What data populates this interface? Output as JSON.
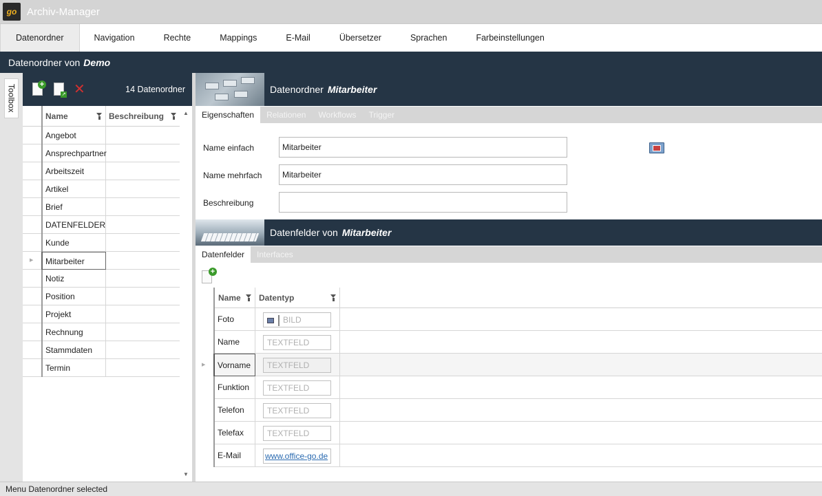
{
  "window": {
    "logo_text": "go",
    "title": "Archiv-Manager"
  },
  "menu": {
    "items": [
      {
        "label": "Datenordner"
      },
      {
        "label": "Navigation"
      },
      {
        "label": "Rechte"
      },
      {
        "label": "Mappings"
      },
      {
        "label": "E-Mail"
      },
      {
        "label": "Übersetzer"
      },
      {
        "label": "Sprachen"
      },
      {
        "label": "Farbeinstellungen"
      }
    ],
    "active_index": 0
  },
  "section": {
    "prefix": "Datenordner von",
    "name": "Demo"
  },
  "toolbox": {
    "label": "Toolbox"
  },
  "left": {
    "count_text": "14 Datenordner",
    "columns": {
      "name": "Name",
      "description": "Beschreibung"
    },
    "rows": [
      {
        "name": "Angebot"
      },
      {
        "name": "Ansprechpartner"
      },
      {
        "name": "Arbeitszeit"
      },
      {
        "name": "Artikel"
      },
      {
        "name": "Brief"
      },
      {
        "name": "DATENFELDER"
      },
      {
        "name": "Kunde"
      },
      {
        "name": "Mitarbeiter"
      },
      {
        "name": "Notiz"
      },
      {
        "name": "Position"
      },
      {
        "name": "Projekt"
      },
      {
        "name": "Rechnung"
      },
      {
        "name": "Stammdaten"
      },
      {
        "name": "Termin"
      }
    ],
    "selected_index": 7
  },
  "folder": {
    "header_prefix": "Datenordner",
    "header_name": "Mitarbeiter",
    "tabs": [
      {
        "label": "Eigenschaften"
      },
      {
        "label": "Relationen"
      },
      {
        "label": "Workflows"
      },
      {
        "label": "Trigger"
      }
    ],
    "active_tab": 0,
    "form": {
      "name_single_label": "Name einfach",
      "name_single_value": "Mitarbeiter",
      "name_plural_label": "Name mehrfach",
      "name_plural_value": "Mitarbeiter",
      "description_label": "Beschreibung",
      "description_value": ""
    }
  },
  "fields": {
    "header_prefix": "Datenfelder von",
    "header_name": "Mitarbeiter",
    "tabs": [
      {
        "label": "Datenfelder"
      },
      {
        "label": "Interfaces"
      }
    ],
    "active_tab": 0,
    "columns": {
      "name": "Name",
      "type": "Datentyp"
    },
    "rows": [
      {
        "name": "Foto",
        "type": "BILD",
        "kind": "image"
      },
      {
        "name": "Name",
        "type": "TEXTFELD",
        "kind": "text"
      },
      {
        "name": "Vorname",
        "type": "TEXTFELD",
        "kind": "text-disabled"
      },
      {
        "name": "Funktion",
        "type": "TEXTFELD",
        "kind": "text"
      },
      {
        "name": "Telefon",
        "type": "TEXTFELD",
        "kind": "text"
      },
      {
        "name": "Telefax",
        "type": "TEXTFELD",
        "kind": "text"
      },
      {
        "name": "E-Mail",
        "type": "www.office-go.de",
        "kind": "link"
      }
    ],
    "selected_index": 2
  },
  "status": {
    "text": "Menu Datenordner selected"
  },
  "colors": {
    "header_bg": "#253545",
    "tab_bar": "#d6d6d6",
    "menu_active": "#ececec",
    "link": "#2a6ab0"
  }
}
